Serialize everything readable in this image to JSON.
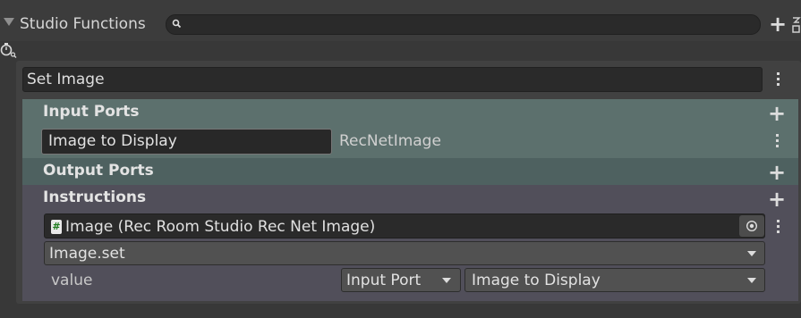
{
  "header": {
    "title": "Studio Functions",
    "search": {
      "value": "",
      "placeholder": ""
    },
    "add_symbol": "+"
  },
  "function": {
    "name": "Set Image",
    "input_ports": {
      "title": "Input Ports",
      "add_symbol": "+",
      "ports": [
        {
          "name": "Image to Display",
          "type": "RecNetImage"
        }
      ]
    },
    "output_ports": {
      "title": "Output Ports",
      "add_symbol": "+"
    },
    "instructions": {
      "title": "Instructions",
      "add_symbol": "+",
      "items": [
        {
          "object_badge": "#",
          "object": "Image (Rec Room Studio Rec Net Image)",
          "method": "Image.set",
          "params": [
            {
              "label": "value",
              "source": "Input Port",
              "port": "Image to Display"
            }
          ]
        }
      ]
    }
  },
  "icons": {
    "foldout": "triangle-down-icon",
    "search": "search-icon",
    "add": "plus-icon",
    "layout": "layout-icon",
    "filter": "stopwatch-search-icon",
    "menu": "kebab-menu-icon",
    "object_picker": "object-picker-icon",
    "script_badge": "script-icon",
    "dropdown": "caret-down-icon"
  },
  "colors": {
    "background": "#383838",
    "input_ports_section": "#5c706d",
    "output_ports_section": "#4e6160",
    "instructions_section": "#514f5a"
  }
}
